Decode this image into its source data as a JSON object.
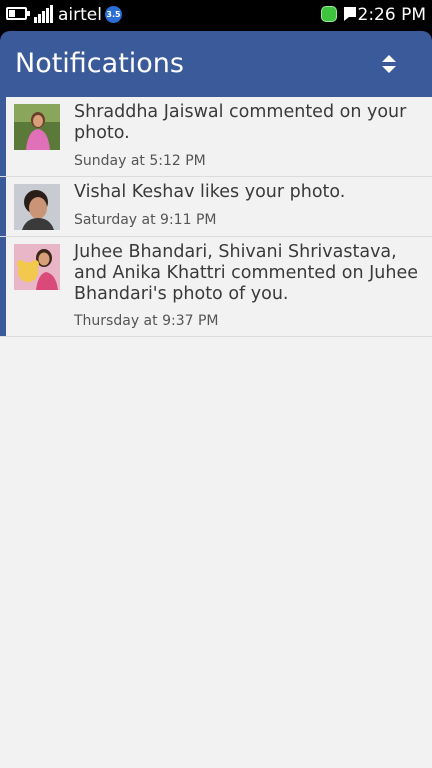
{
  "status_bar": {
    "carrier": "airtel",
    "network_badge": "3.5",
    "time": "2:26 PM",
    "icons": {
      "battery": "battery-icon",
      "signal": "signal-strength-icon",
      "chat": "chat-status-icon",
      "notification": "notification-flag-icon"
    },
    "colors": {
      "network_badge": "#2a6fd6",
      "chat_indicator": "#3fc43f"
    }
  },
  "header": {
    "title": "Notifications",
    "sort_icon": "sort-up-down-icon",
    "color": "#3b5a9a"
  },
  "notifications": [
    {
      "text": "Shraddha Jaiswal commented on your photo.",
      "time": "Sunday at 5:12 PM",
      "unread": true,
      "avatar": "avatar-photo"
    },
    {
      "text": "Vishal Keshav likes your photo.",
      "time": "Saturday at 9:11 PM",
      "unread": true,
      "avatar": "avatar-photo"
    },
    {
      "text": "Juhee Bhandari, Shivani Shrivastava, and Anika Khattri commented on Juhee Bhandari's photo of you.",
      "time": "Thursday at 9:37 PM",
      "unread": true,
      "avatar": "avatar-photo"
    }
  ]
}
